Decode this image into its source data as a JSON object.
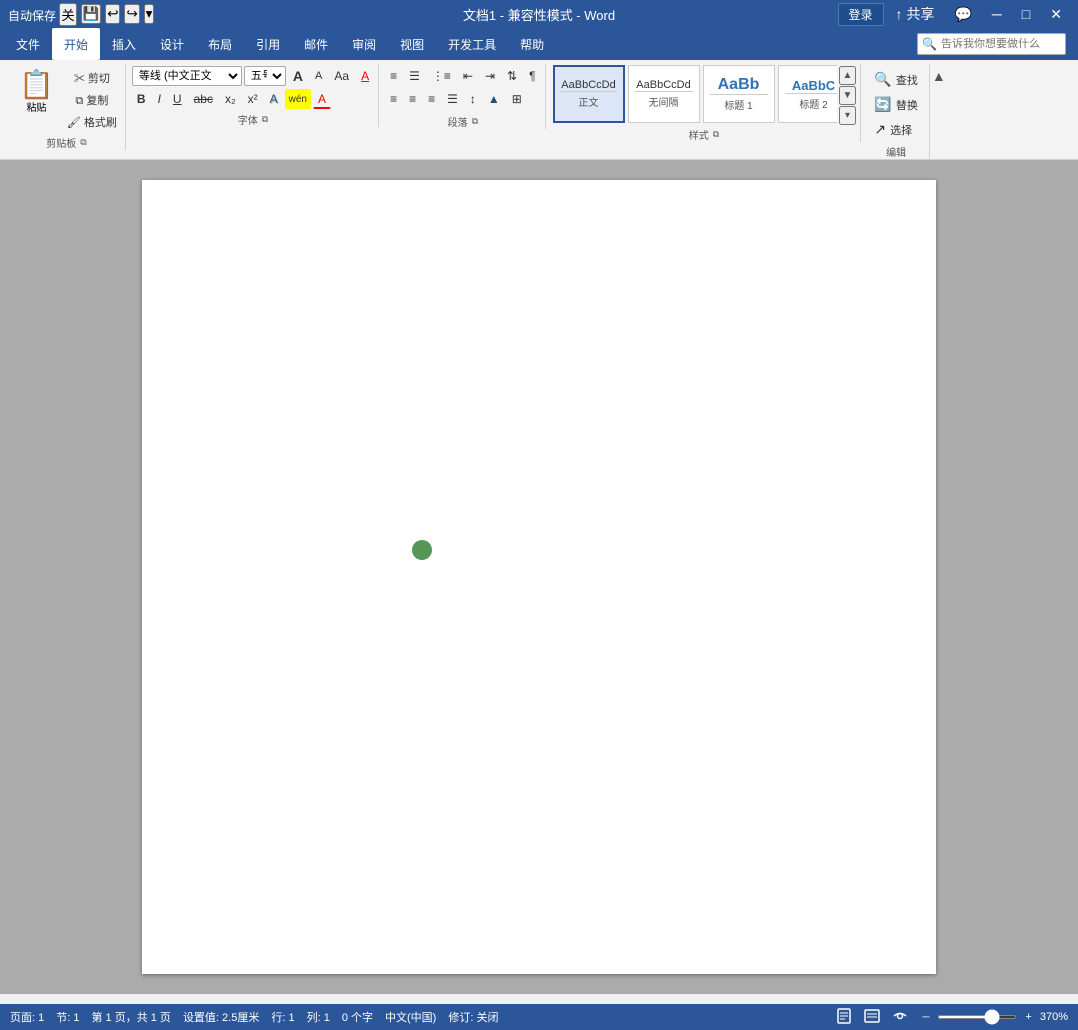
{
  "titlebar": {
    "autosave_label": "自动保存",
    "autosave_state": "关",
    "title": "文档1 - 兼容性模式 - Word",
    "signin_label": "登录",
    "share_label": "共享",
    "minimize_icon": "─",
    "restore_icon": "□",
    "close_icon": "✕"
  },
  "menubar": {
    "items": [
      {
        "id": "file",
        "label": "文件"
      },
      {
        "id": "home",
        "label": "开始",
        "active": true
      },
      {
        "id": "insert",
        "label": "插入"
      },
      {
        "id": "design",
        "label": "设计"
      },
      {
        "id": "layout",
        "label": "布局"
      },
      {
        "id": "references",
        "label": "引用"
      },
      {
        "id": "mailings",
        "label": "邮件"
      },
      {
        "id": "review",
        "label": "审阅"
      },
      {
        "id": "view",
        "label": "视图"
      },
      {
        "id": "developer",
        "label": "开发工具"
      },
      {
        "id": "help",
        "label": "帮助"
      }
    ]
  },
  "ribbon": {
    "clipboard": {
      "group_label": "剪贴板",
      "paste_label": "粘贴",
      "cut_label": "剪切",
      "copy_label": "复制",
      "format_painter_label": "格式刷"
    },
    "font": {
      "group_label": "字体",
      "font_name": "等线 (中文正文",
      "font_size": "五号",
      "grow_font": "A",
      "shrink_font": "A",
      "change_case": "Aa",
      "clear_format": "A",
      "text_highlight": "wén",
      "font_color_a": "A",
      "bold": "B",
      "italic": "I",
      "underline": "U",
      "strikethrough": "abc",
      "subscript": "x₂",
      "superscript": "x²",
      "text_effects": "A",
      "font_color": "A"
    },
    "paragraph": {
      "group_label": "段落",
      "bullets": "≡",
      "numbering": "≡",
      "multilevel": "≡",
      "decrease_indent": "⇐",
      "increase_indent": "⇒",
      "sort": "↕",
      "show_marks": "¶",
      "align_left": "≡",
      "align_center": "≡",
      "align_right": "≡",
      "justify": "≡",
      "line_spacing": "↕",
      "shading": "▲",
      "borders": "⊞"
    },
    "styles": {
      "group_label": "样式",
      "items": [
        {
          "id": "normal",
          "label": "AaBbCcDd",
          "name": "正文",
          "selected": true
        },
        {
          "id": "no_spacing",
          "label": "AaBbCcDd",
          "name": "无间隔"
        },
        {
          "id": "heading1",
          "label": "AaBb",
          "name": "标题 1"
        },
        {
          "id": "heading2",
          "label": "AaBbC",
          "name": "标题 2"
        }
      ]
    },
    "editing": {
      "group_label": "编辑",
      "find_label": "查找",
      "replace_label": "替换",
      "select_label": "选择"
    },
    "search": {
      "placeholder": "告诉我你想要做什么"
    }
  },
  "document": {
    "page_content": ""
  },
  "statusbar": {
    "page_label": "页面: 1",
    "section_label": "节: 1",
    "page_count": "第 1 页，共 1 页",
    "words_label": "设置值: 2.5厘米",
    "line_label": "行: 1",
    "col_label": "列: 1",
    "char_count": "0 个字",
    "language": "中文(中国)",
    "track_changes": "修订: 关闭",
    "zoom_pct": "370%"
  }
}
